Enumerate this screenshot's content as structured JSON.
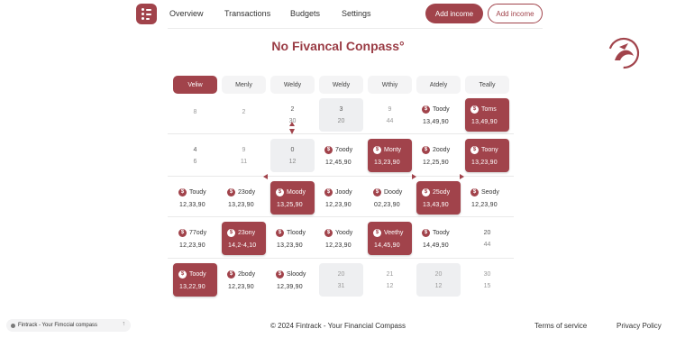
{
  "nav": {
    "links": [
      "Overview",
      "Transactions",
      "Budgets",
      "Settings"
    ],
    "add_income_primary": "Add income",
    "add_income_outline": "Add income"
  },
  "title": "No Fivancal Conpass°",
  "colors": {
    "accent": "#a1434b",
    "cell_grey": "#eeeff1",
    "header_bg": "#f4f4f5"
  },
  "grid": {
    "headers": [
      "Veliw",
      "Menly",
      "Weldy",
      "Weldy",
      "Wthiy",
      "Atdely",
      "Teally"
    ],
    "rows": [
      [
        {
          "style": "plain-faint",
          "l1": "8",
          "l2": ""
        },
        {
          "style": "plain-faint",
          "l1": "2",
          "l2": ""
        },
        {
          "style": "plain",
          "l1": "2",
          "l2": "30"
        },
        {
          "style": "grey",
          "l1": "3",
          "l2": "20"
        },
        {
          "style": "plain-faint",
          "l1": "9",
          "l2": "44"
        },
        {
          "style": "rich",
          "l1": "Toody",
          "l2": "13,49,90"
        },
        {
          "style": "rich-red",
          "l1": "Toms",
          "l2": "13,49,90"
        }
      ],
      [
        {
          "style": "plain",
          "l1": "4",
          "l2": "6"
        },
        {
          "style": "plain-faint",
          "l1": "9",
          "l2": "11"
        },
        {
          "style": "grey",
          "l1": "0",
          "l2": "12"
        },
        {
          "style": "rich",
          "l1": "7oody",
          "l2": "12,45,90"
        },
        {
          "style": "rich-red",
          "l1": "Monty",
          "l2": "13,23,90"
        },
        {
          "style": "rich",
          "l1": "2oody",
          "l2": "12,25,90"
        },
        {
          "style": "rich-red",
          "l1": "Toony",
          "l2": "13,23,90"
        }
      ],
      [
        {
          "style": "rich",
          "l1": "Toudy",
          "l2": "12,33,90"
        },
        {
          "style": "rich",
          "l1": "23ody",
          "l2": "13,23,90"
        },
        {
          "style": "rich-red",
          "l1": "Moody",
          "l2": "13,25,90"
        },
        {
          "style": "rich",
          "l1": "Joody",
          "l2": "12,23,90"
        },
        {
          "style": "rich",
          "l1": "Doody",
          "l2": "02,23,90"
        },
        {
          "style": "rich-red",
          "l1": "25ody",
          "l2": "13,43,90"
        },
        {
          "style": "rich",
          "l1": "Seody",
          "l2": "12,23,90"
        }
      ],
      [
        {
          "style": "rich",
          "l1": "77ody",
          "l2": "12,23,90"
        },
        {
          "style": "rich-red",
          "l1": "23ony",
          "l2": "14,2-4,10"
        },
        {
          "style": "rich",
          "l1": "Tloody",
          "l2": "13,23,90"
        },
        {
          "style": "rich",
          "l1": "Yoody",
          "l2": "12,23,90"
        },
        {
          "style": "rich-red",
          "l1": "Veethy",
          "l2": "14,45,90"
        },
        {
          "style": "rich",
          "l1": "Toody",
          "l2": "14,49,90"
        },
        {
          "style": "plain",
          "l1": "20",
          "l2": "44"
        }
      ],
      [
        {
          "style": "rich-red",
          "l1": "Toody",
          "l2": "13,22,90"
        },
        {
          "style": "rich",
          "l1": "2body",
          "l2": "12,23,90"
        },
        {
          "style": "rich",
          "l1": "Sloody",
          "l2": "12,39,90"
        },
        {
          "style": "grey-faint",
          "l1": "20",
          "l2": "31"
        },
        {
          "style": "plain-faint",
          "l1": "21",
          "l2": "12"
        },
        {
          "style": "grey-faint",
          "l1": "20",
          "l2": "12"
        },
        {
          "style": "plain-faint",
          "l1": "30",
          "l2": "15"
        }
      ]
    ]
  },
  "footer": {
    "pill": "Fintrack - Your Fimccial compass",
    "pill_icon": "arrow-up-icon",
    "copyright": "© 2024 Fintrack - Your Financial Compass",
    "terms": "Terms of service",
    "privacy": "Privacy Policy"
  }
}
